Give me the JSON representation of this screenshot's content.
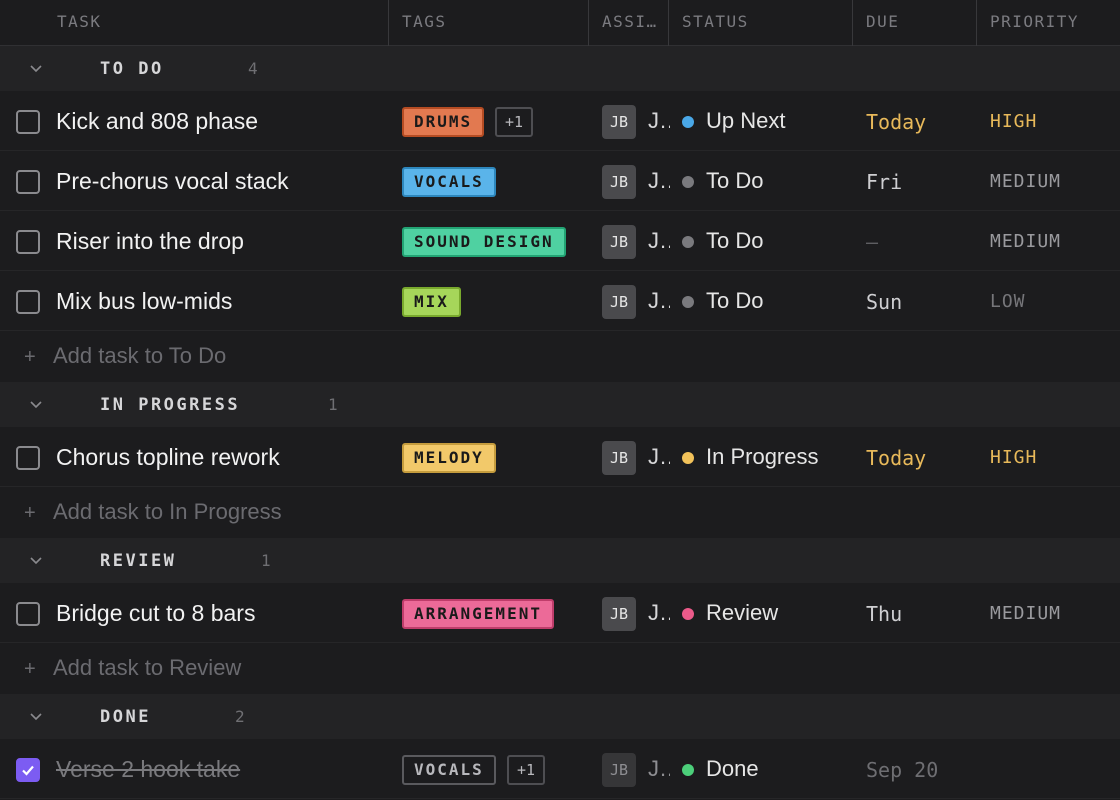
{
  "columns": {
    "task": "TASK",
    "tags": "TAGS",
    "assignee": "ASSI…",
    "status": "STATUS",
    "due": "DUE",
    "priority": "PRIORITY"
  },
  "colors": {
    "accent": "#7c5cf2",
    "high": "#e8b95a",
    "medium": "#9a9a9e",
    "low": "#76767a"
  },
  "groups": {
    "todo": {
      "name": "TO DO",
      "count": "4",
      "add_label": "Add task to To Do"
    },
    "inprogress": {
      "name": "IN PROGRESS",
      "count": "1",
      "add_label": "Add task to In Progress"
    },
    "review": {
      "name": "REVIEW",
      "count": "1",
      "add_label": "Add task to Review"
    },
    "done": {
      "name": "DONE",
      "count": "2"
    }
  },
  "add_symbol": "+",
  "tasks": [
    {
      "name": "Kick and 808 phase",
      "tag": "DRUMS",
      "tag_color": "#e27950",
      "extra": "+1",
      "initials": "JB",
      "assignee": "J…",
      "status": "Up Next",
      "status_color": "#4aa8e8",
      "due": "Today",
      "priority": "HIGH",
      "checked": false
    },
    {
      "name": "Pre-chorus vocal stack",
      "tag": "VOCALS",
      "tag_color": "#5ab4ea",
      "initials": "JB",
      "assignee": "J…",
      "status": "To Do",
      "status_color": "#7a7a7e",
      "due": "Fri",
      "priority": "MEDIUM",
      "checked": false
    },
    {
      "name": "Riser into the drop",
      "tag": "SOUND DESIGN",
      "tag_color": "#4fd1a1",
      "initials": "JB",
      "assignee": "J…",
      "status": "To Do",
      "status_color": "#7a7a7e",
      "due": "—",
      "priority": "MEDIUM",
      "checked": false
    },
    {
      "name": "Mix bus low-mids",
      "tag": "MIX",
      "tag_color": "#a6d65a",
      "initials": "JB",
      "assignee": "J…",
      "status": "To Do",
      "status_color": "#7a7a7e",
      "due": "Sun",
      "priority": "LOW",
      "checked": false
    },
    {
      "name": "Chorus topline rework",
      "tag": "MELODY",
      "tag_color": "#f2c96a",
      "initials": "JB",
      "assignee": "J…",
      "status": "In Progress",
      "status_color": "#f2c25a",
      "due": "Today",
      "priority": "HIGH",
      "checked": false
    },
    {
      "name": "Bridge cut to 8 bars",
      "tag": "ARRANGEMENT",
      "tag_color": "#ec6a98",
      "initials": "JB",
      "assignee": "J…",
      "status": "Review",
      "status_color": "#ec5a8a",
      "due": "Thu",
      "priority": "MEDIUM",
      "checked": false
    },
    {
      "name": "Verse 2 hook take",
      "tag": "VOCALS",
      "extra": "+1",
      "initials": "JB",
      "assignee": "J…",
      "status": "Done",
      "status_color": "#4ccf7a",
      "due": "Sep 20",
      "checked": true
    }
  ]
}
